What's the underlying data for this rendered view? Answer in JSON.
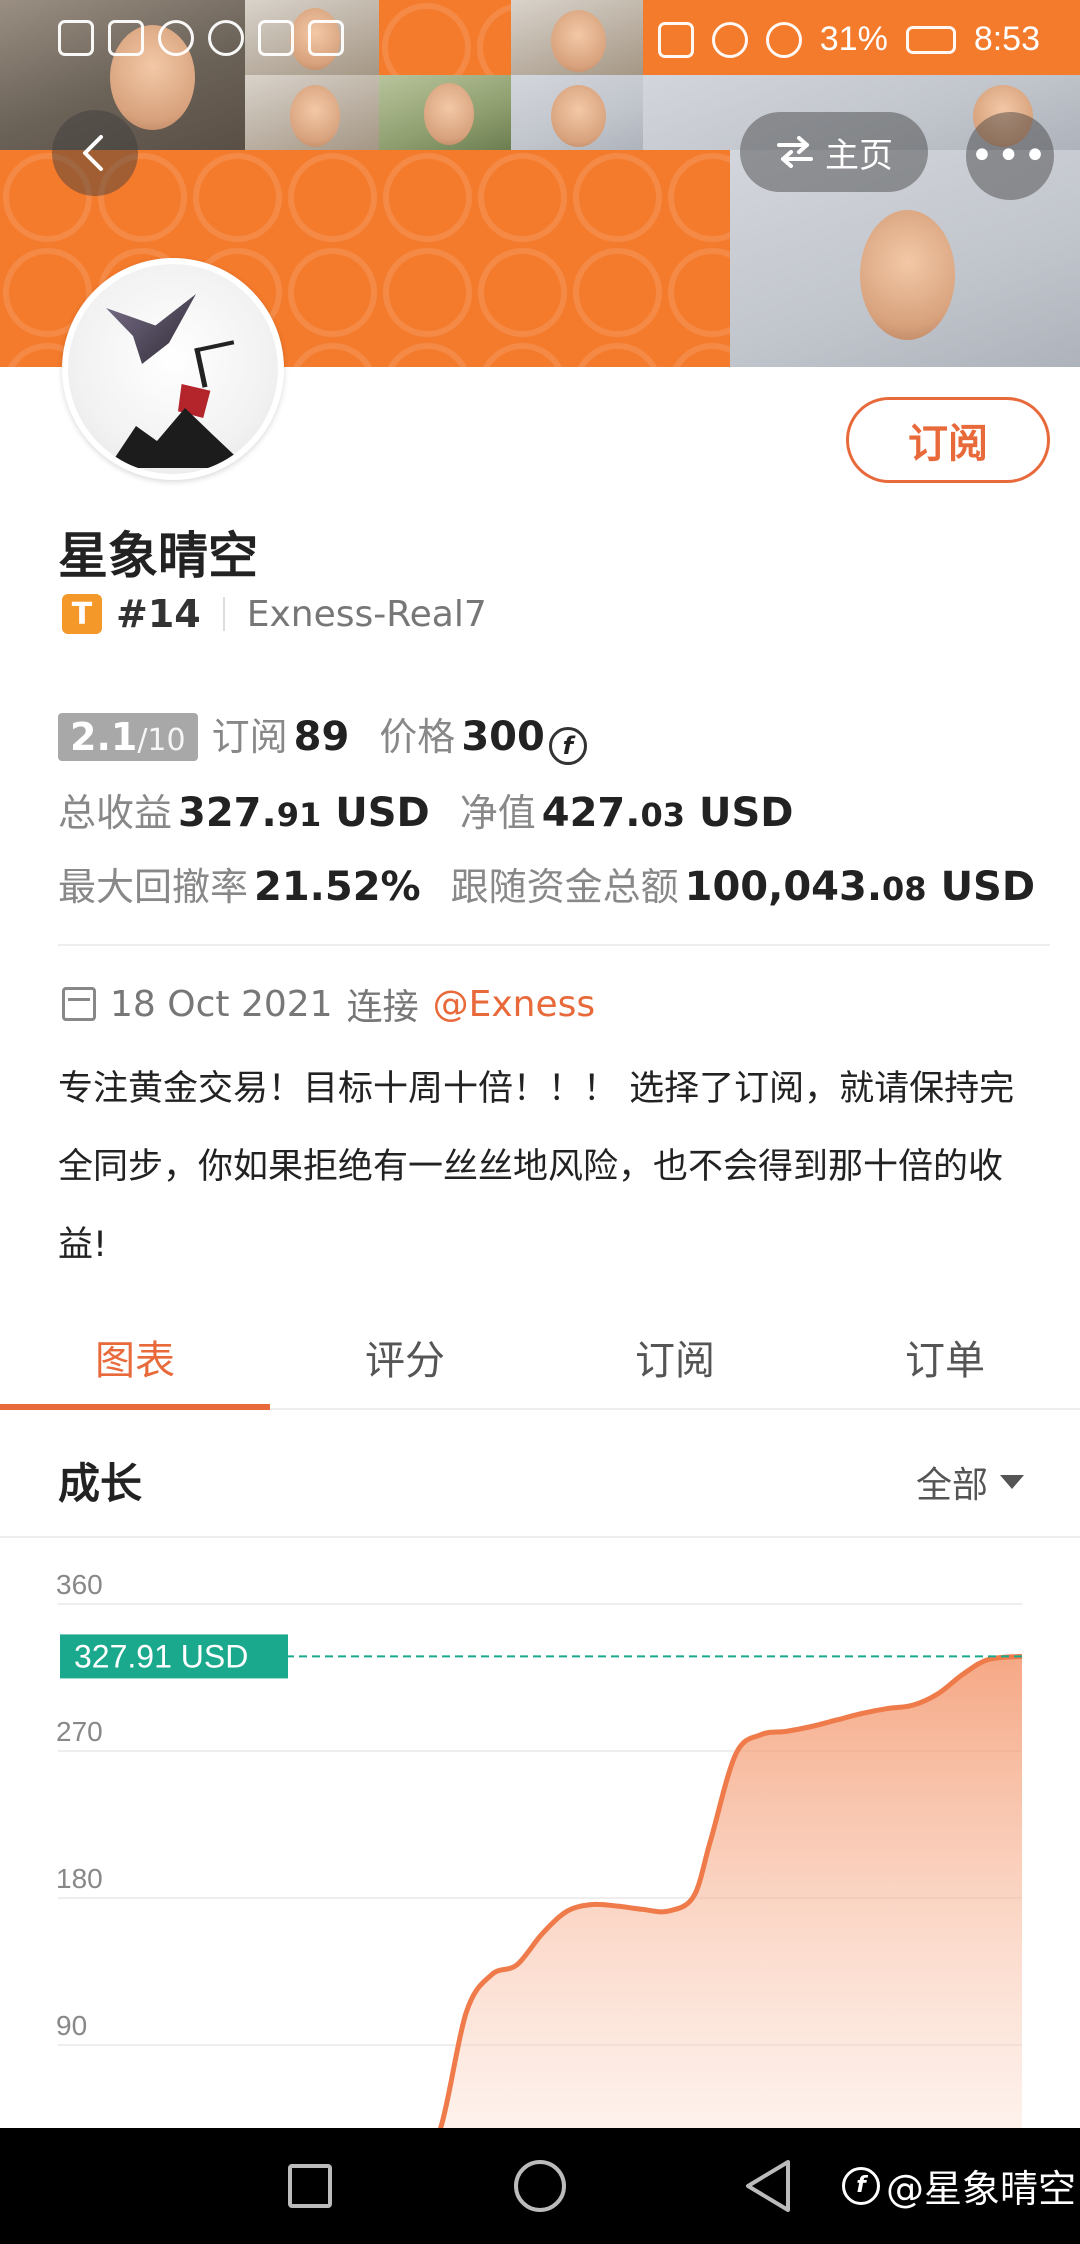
{
  "status_bar": {
    "left_icons": [
      "hd-icon",
      "signal-icon",
      "signal-icon",
      "hotspot-icon",
      "eye-icon",
      "app-icon",
      "app-icon",
      "app-icon"
    ],
    "battery": "31%",
    "time": "8:53"
  },
  "header": {
    "home_label": "主页",
    "more_label": "•••"
  },
  "profile": {
    "name": "星象晴空",
    "badge": "T",
    "rank": "#14",
    "account": "Exness-Real7",
    "subscribe_label": "订阅"
  },
  "stats": {
    "score_main": "2.1",
    "score_sub": "/10",
    "subs_label": "订阅",
    "subs_value": "89",
    "price_label": "价格",
    "price_value": "300",
    "coin_symbol": "f",
    "total_profit_label": "总收益",
    "total_profit_int": "327.",
    "total_profit_dec": "91",
    "total_profit_cur": "USD",
    "equity_label": "净值",
    "equity_int": "427.",
    "equity_dec": "03",
    "equity_cur": "USD",
    "drawdown_label": "最大回撤率",
    "drawdown_value": "21.52%",
    "follow_label": "跟随资金总额",
    "follow_int": "100,043.",
    "follow_dec": "08",
    "follow_cur": "USD"
  },
  "connection": {
    "date": "18 Oct 2021",
    "connect_label": "连接",
    "broker": "@Exness"
  },
  "description": "专注黄金交易！目标十周十倍！！！ 选择了订阅，就请保持完全同步，你如果拒绝有一丝丝地风险，也不会得到那十倍的收益!",
  "tabs": [
    {
      "label": "图表",
      "active": true
    },
    {
      "label": "评分",
      "active": false
    },
    {
      "label": "订阅",
      "active": false
    },
    {
      "label": "订单",
      "active": false
    }
  ],
  "growth": {
    "title": "成长",
    "range": "全部"
  },
  "colors": {
    "accent": "#e8693a",
    "chart_line": "#ef7a4a",
    "marker": "#1aa98c"
  },
  "chart_data": {
    "type": "area",
    "yticks": [
      "360",
      "270",
      "180",
      "90"
    ],
    "ylim": [
      0,
      360
    ],
    "current_label": "327.91 USD",
    "current_value": 327.91,
    "x": [
      0,
      5,
      10,
      15,
      20,
      25,
      28,
      31,
      34,
      37,
      40,
      43,
      46,
      49,
      52,
      55,
      58,
      61,
      63,
      66,
      69,
      72,
      75,
      78,
      81,
      84,
      87,
      90,
      93,
      96,
      100
    ],
    "values": [
      0,
      0,
      1,
      2,
      3,
      4,
      8,
      40,
      110,
      133,
      139,
      158,
      172,
      176,
      175,
      173,
      172,
      181,
      215,
      268,
      280,
      282,
      285,
      289,
      293,
      296,
      298,
      305,
      317,
      326,
      327.91
    ]
  },
  "watermark": "@星象晴空",
  "watermark_logo": "f"
}
